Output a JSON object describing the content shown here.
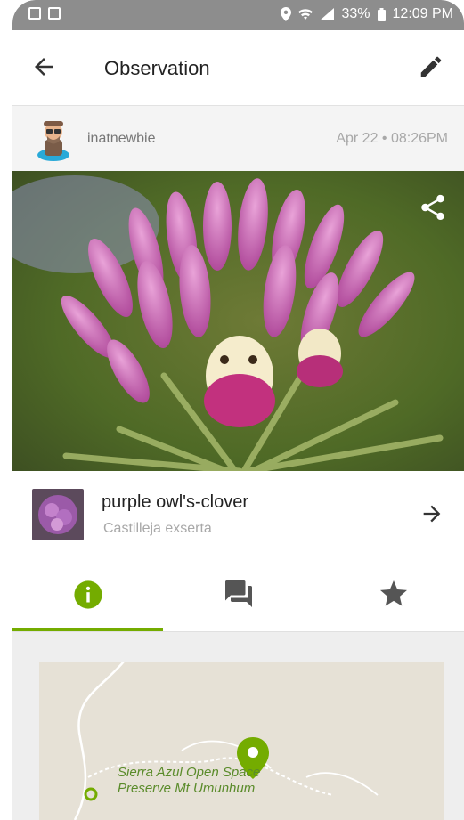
{
  "status_bar": {
    "battery": "33%",
    "time": "12:09 PM"
  },
  "app_bar": {
    "title": "Observation",
    "back_icon": "arrow-back-icon",
    "edit_icon": "pencil-icon"
  },
  "observer": {
    "username": "inatnewbie",
    "date": "Apr 22 • 08:26PM"
  },
  "photo": {
    "share_icon": "share-icon"
  },
  "taxon": {
    "common_name": "purple owl's-clover",
    "scientific_name": "Castilleja exserta"
  },
  "tabs": [
    {
      "name": "info",
      "icon": "info-icon",
      "active": true
    },
    {
      "name": "comments",
      "icon": "comments-icon",
      "active": false
    },
    {
      "name": "favorites",
      "icon": "star-icon",
      "active": false
    }
  ],
  "map": {
    "place_line1": "Sierra Azul Open Space",
    "place_line2": "Preserve Mt Umunhum"
  },
  "colors": {
    "accent": "#74ac00",
    "status_bar": "#8d8d8d"
  }
}
